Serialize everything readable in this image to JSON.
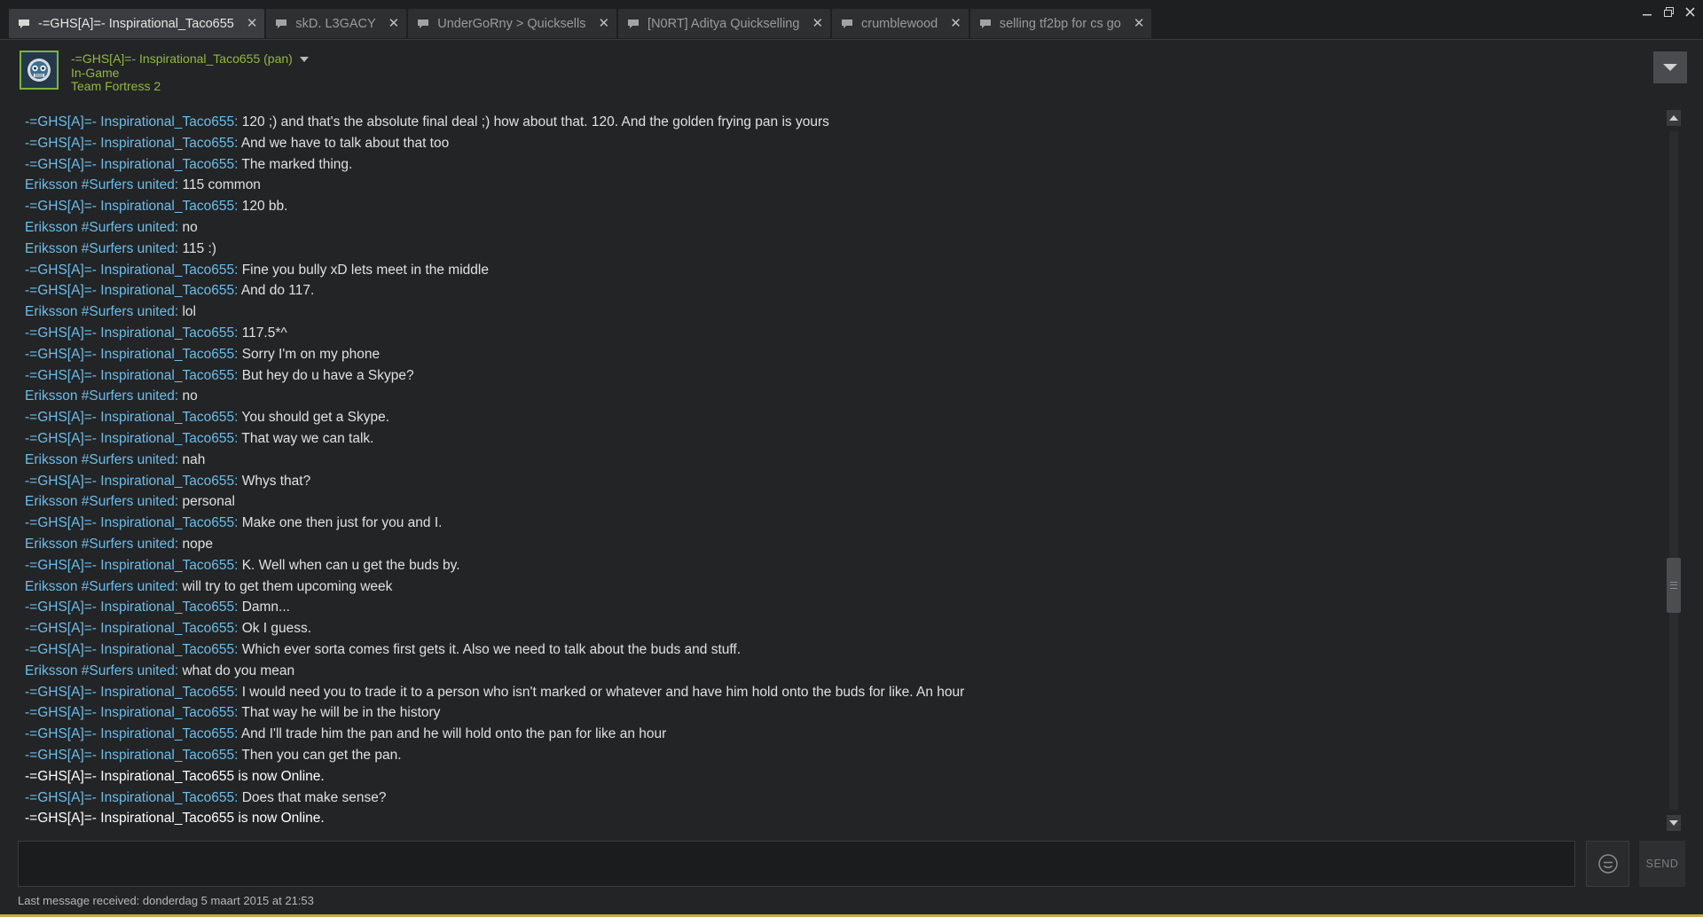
{
  "tabs": [
    {
      "label": "-=GHS[A]=- Inspirational_Taco655",
      "active": true
    },
    {
      "label": "skD. L3GACY",
      "active": false
    },
    {
      "label": "UnderGoRny > Quicksells",
      "active": false
    },
    {
      "label": "[N0RT] Aditya Quickselling",
      "active": false
    },
    {
      "label": "crumblewood",
      "active": false
    },
    {
      "label": "selling tf2bp for cs go",
      "active": false
    }
  ],
  "friend": {
    "name": "-=GHS[A]=- Inspirational_Taco655 (pan)",
    "status": "In-Game",
    "game": "Team Fortress 2"
  },
  "messages": [
    {
      "who": "-=GHS[A]=- Inspirational_Taco655:",
      "text": " 120 ;) and that's the absolute final deal ;) how about that. 120. And the golden frying pan is yours"
    },
    {
      "who": "-=GHS[A]=- Inspirational_Taco655:",
      "text": " And we have to talk about that too"
    },
    {
      "who": "-=GHS[A]=- Inspirational_Taco655:",
      "text": " The marked thing."
    },
    {
      "who": "Eriksson #Surfers united:",
      "text": " 115 common"
    },
    {
      "who": "-=GHS[A]=- Inspirational_Taco655:",
      "text": " 120 bb."
    },
    {
      "who": "Eriksson #Surfers united:",
      "text": " no"
    },
    {
      "who": "Eriksson #Surfers united:",
      "text": " 115 :)"
    },
    {
      "who": "-=GHS[A]=- Inspirational_Taco655:",
      "text": " Fine you bully xD lets meet in the middle"
    },
    {
      "who": "-=GHS[A]=- Inspirational_Taco655:",
      "text": " And do 117."
    },
    {
      "who": "Eriksson #Surfers united:",
      "text": " lol"
    },
    {
      "who": "-=GHS[A]=- Inspirational_Taco655:",
      "text": " 117.5*^"
    },
    {
      "who": "-=GHS[A]=- Inspirational_Taco655:",
      "text": " Sorry I'm on my phone"
    },
    {
      "who": "-=GHS[A]=- Inspirational_Taco655:",
      "text": " But hey do u have a Skype?"
    },
    {
      "who": "Eriksson #Surfers united:",
      "text": " no"
    },
    {
      "who": "-=GHS[A]=- Inspirational_Taco655:",
      "text": " You should get a Skype."
    },
    {
      "who": "-=GHS[A]=- Inspirational_Taco655:",
      "text": " That way we can talk."
    },
    {
      "who": "Eriksson #Surfers united:",
      "text": " nah"
    },
    {
      "who": "-=GHS[A]=- Inspirational_Taco655:",
      "text": " Whys that?"
    },
    {
      "who": "Eriksson #Surfers united:",
      "text": " personal"
    },
    {
      "who": "-=GHS[A]=- Inspirational_Taco655:",
      "text": " Make one then just for you and I."
    },
    {
      "who": "Eriksson #Surfers united:",
      "text": " nope"
    },
    {
      "who": "-=GHS[A]=- Inspirational_Taco655:",
      "text": " K. Well when can u get the buds by."
    },
    {
      "who": "Eriksson #Surfers united:",
      "text": " will try to get them upcoming week"
    },
    {
      "who": "-=GHS[A]=- Inspirational_Taco655:",
      "text": " Damn..."
    },
    {
      "who": "-=GHS[A]=- Inspirational_Taco655:",
      "text": " Ok I guess."
    },
    {
      "who": "-=GHS[A]=- Inspirational_Taco655:",
      "text": " Which ever sorta comes first gets it. Also we need to talk about the buds and stuff."
    },
    {
      "who": "Eriksson #Surfers united:",
      "text": " what do you mean"
    },
    {
      "who": "-=GHS[A]=- Inspirational_Taco655:",
      "text": " I would need you to trade it to a person who isn't marked or whatever and have him hold onto the buds for like. An hour"
    },
    {
      "who": "-=GHS[A]=- Inspirational_Taco655:",
      "text": " That way he will be in the history"
    },
    {
      "who": "-=GHS[A]=- Inspirational_Taco655:",
      "text": " And I'll trade him the pan and he will hold onto the pan for like an hour"
    },
    {
      "who": "-=GHS[A]=- Inspirational_Taco655:",
      "text": " Then you can get the pan."
    },
    {
      "who": "",
      "text": "-=GHS[A]=- Inspirational_Taco655 is now Online.",
      "system": true
    },
    {
      "who": "-=GHS[A]=- Inspirational_Taco655:",
      "text": " Does that make sense?"
    },
    {
      "who": "",
      "text": "-=GHS[A]=- Inspirational_Taco655 is now Online.",
      "system": true
    }
  ],
  "input": {
    "value": "",
    "send_label": "SEND"
  },
  "footer": {
    "last_message": "Last message received: donderdag 5 maart 2015 at 21:53"
  },
  "colors": {
    "name": "#6dbde8",
    "ingame": "#90ba3c",
    "text": "#e0e0e0",
    "bg": "#232426"
  },
  "icons": {
    "tab": "chat-bubble-icon",
    "close": "close-icon",
    "emoji": "emoticon-icon"
  }
}
